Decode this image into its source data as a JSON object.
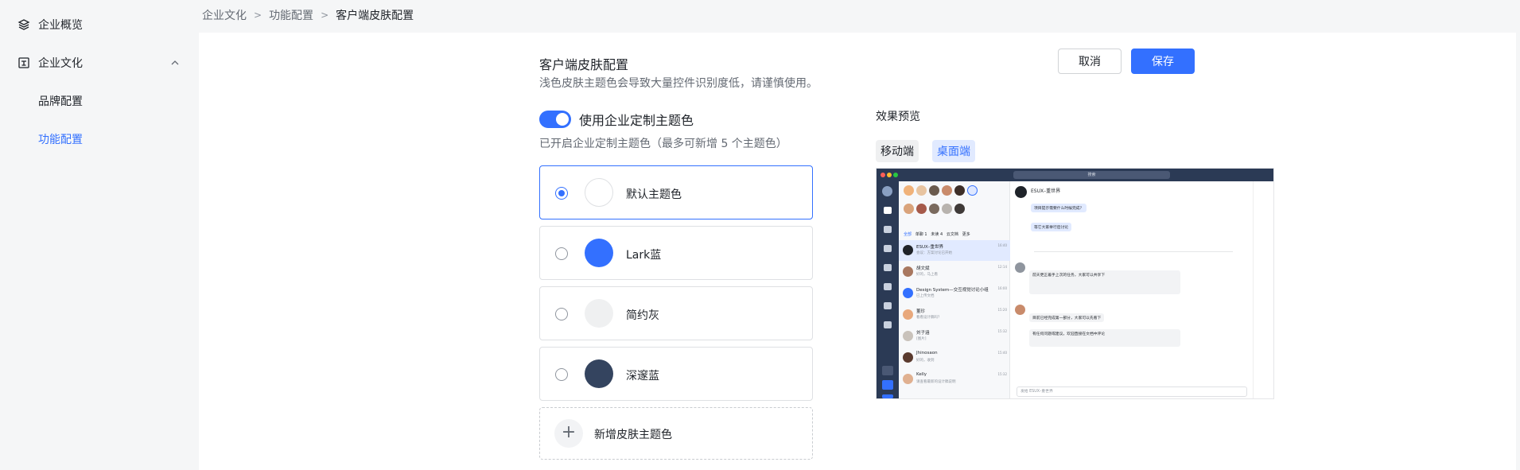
{
  "sidebar": {
    "items": [
      {
        "label": "企业概览",
        "icon": "layers-icon"
      },
      {
        "label": "企业文化",
        "icon": "culture-icon",
        "expanded": true,
        "children": [
          {
            "label": "品牌配置",
            "active": false
          },
          {
            "label": "功能配置",
            "active": true
          }
        ]
      }
    ]
  },
  "breadcrumb": {
    "items": [
      "企业文化",
      "功能配置",
      "客户端皮肤配置"
    ],
    "separator": ">"
  },
  "page": {
    "title": "客户端皮肤配置",
    "subtitle": "浅色皮肤主题色会导致大量控件识别度低，请谨慎使用。",
    "cancel_label": "取消",
    "save_label": "保存"
  },
  "custom_theme": {
    "enabled": true,
    "toggle_label": "使用企业定制主题色",
    "hint": "已开启企业定制主题色（最多可新增 5 个主题色）"
  },
  "themes": [
    {
      "name": "默认主题色",
      "color": "#ffffff",
      "selected": true
    },
    {
      "name": "Lark蓝",
      "color": "#3370ff",
      "selected": false
    },
    {
      "name": "简约灰",
      "color": "#eff0f1",
      "selected": false
    },
    {
      "name": "深邃蓝",
      "color": "#34445f",
      "selected": false
    }
  ],
  "add_theme_label": "新增皮肤主题色",
  "preview": {
    "label": "效果预览",
    "tabs": [
      {
        "label": "移动端",
        "active": false
      },
      {
        "label": "桌面端",
        "active": true
      }
    ],
    "search_placeholder": "搜索",
    "chat_title": "ESUX–重世界",
    "tabs_row": [
      "全部",
      "单聊 1",
      "未读 4",
      "云文档",
      "更多"
    ],
    "chats": [
      {
        "name": "ESUX–重世界",
        "msg": "会议：方案讨论已开始",
        "time": "16:40"
      },
      {
        "name": "胡文斌",
        "msg": "好的，马上看",
        "time": "12:14"
      },
      {
        "name": "Design System—交互视觉讨论小组",
        "msg": "已上传文档",
        "time": "16:00"
      },
      {
        "name": "董珍",
        "msg": "看看设计稿吗？",
        "time": "15:20"
      },
      {
        "name": "刘子涵",
        "msg": "[图片]",
        "time": "15:32"
      },
      {
        "name": "Jhinosaon",
        "msg": "好的，收到",
        "time": "15:40"
      },
      {
        "name": "Kelly",
        "msg": "请查看最新的设计稿说明",
        "time": "15:32"
      }
    ],
    "messages": [
      "项目提示需要什么时候完成？",
      "等它大家举行后讨论",
      "前天更正着手上次的任务，大家可以共享下",
      "目前已经完成第一部分，大家可以先看下",
      "有任何问题或建议，欢迎直接在文档中评论"
    ],
    "input_placeholder": "发给 ESUX–重世界"
  }
}
